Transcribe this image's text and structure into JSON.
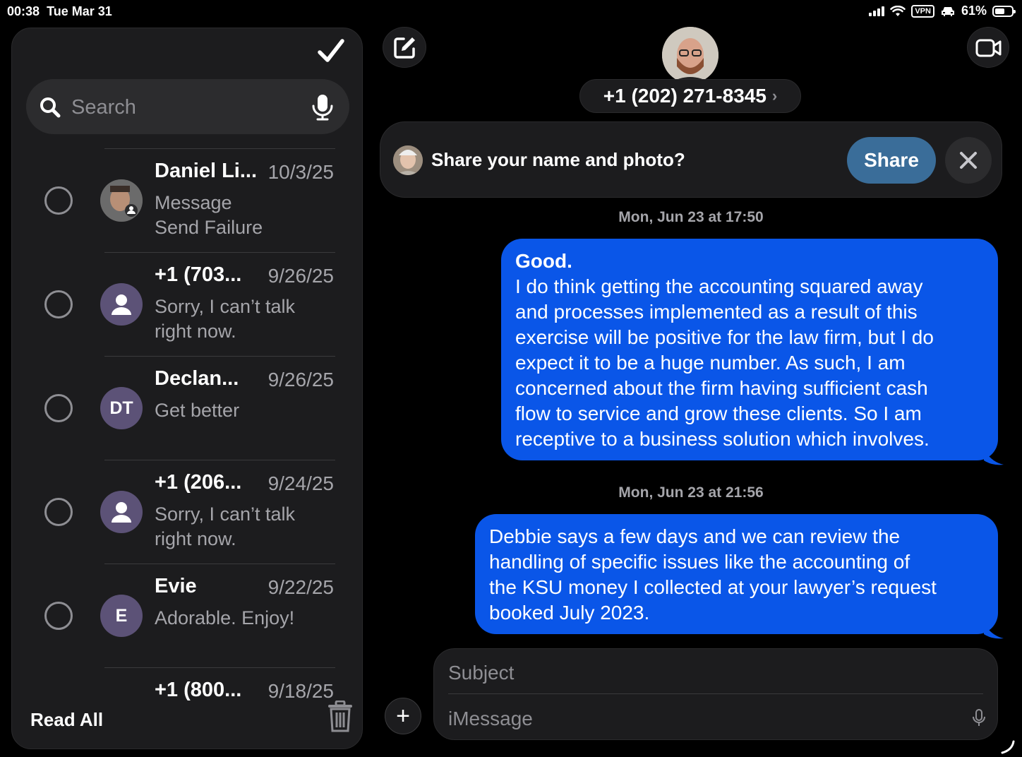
{
  "status_bar": {
    "time": "00:38",
    "date": "Tue Mar 31",
    "vpn": "VPN",
    "battery_percent": "61%",
    "battery_level": 0.61
  },
  "sidebar": {
    "search": {
      "placeholder": "Search",
      "value": ""
    },
    "conversations": [
      {
        "name": "Daniel Li...",
        "date": "10/3/25",
        "preview_lines": [
          "Message",
          "Send Failure"
        ],
        "avatar": "photo"
      },
      {
        "name": "+1 (703...",
        "date": "9/26/25",
        "preview_lines": [
          "Sorry, I can’t talk",
          "right now."
        ],
        "avatar": "person-icon"
      },
      {
        "name": "Declan...",
        "date": "9/26/25",
        "preview_lines": [
          "Get better"
        ],
        "avatar": "DT"
      },
      {
        "name": "+1 (206...",
        "date": "9/24/25",
        "preview_lines": [
          "Sorry, I can’t talk",
          "right now."
        ],
        "avatar": "person-icon"
      },
      {
        "name": "Evie",
        "date": "9/22/25",
        "preview_lines": [
          "Adorable. Enjoy!"
        ],
        "avatar": "E"
      },
      {
        "name": "+1 (800...",
        "date": "9/18/25",
        "preview_lines": [],
        "avatar": "none"
      }
    ],
    "footer": {
      "read_all": "Read All"
    }
  },
  "conversation": {
    "contact_number": "+1 (202) 271-8345",
    "share_banner": {
      "text": "Share your name and photo?",
      "share_label": "Share"
    },
    "messages": [
      {
        "timestamp": "Mon, Jun 23 at 17:50",
        "title": "Good.",
        "lines": [
          "I do think getting the accounting squared away",
          "and processes implemented as a result of this",
          "exercise will be positive for the law firm, but I do",
          "expect it to be a huge number. As such, I am",
          "concerned about the firm having sufficient cash",
          "flow to service and grow these clients. So I am",
          "receptive to a business solution which involves."
        ]
      },
      {
        "timestamp": "Mon, Jun 23 at 21:56",
        "lines": [
          "Debbie says a few days and we can review the",
          "handling of specific issues like the  accounting of",
          "the KSU money I collected at your lawyer’s request",
          "booked July 2023."
        ]
      }
    ],
    "composer": {
      "subject_placeholder": "Subject",
      "message_placeholder": "iMessage"
    }
  },
  "colors": {
    "bubble_blue": "#0a56e8",
    "share_button": "#3a6d99",
    "panel": "#1c1c1e",
    "avatar_purple": "#5c5277"
  }
}
